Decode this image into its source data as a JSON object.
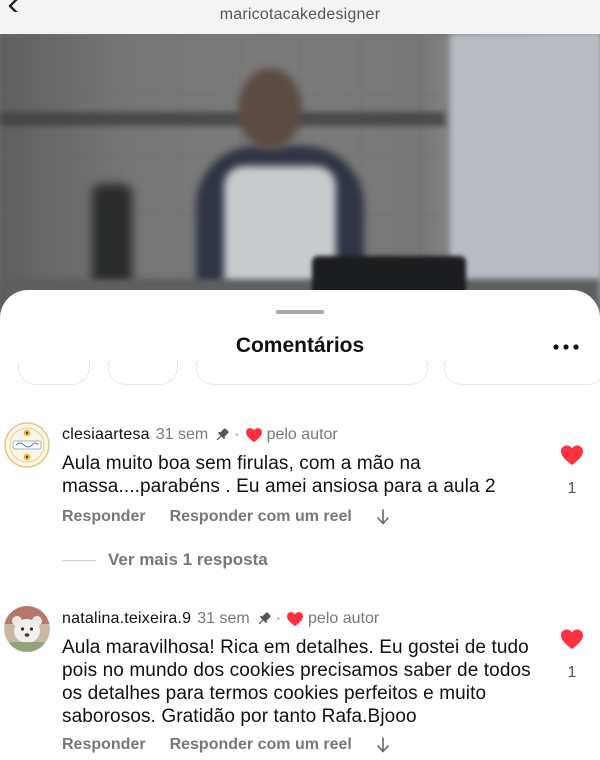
{
  "header": {
    "account_name": "maricotacakedesigner",
    "back_icon": "chevron-left-icon"
  },
  "sheet": {
    "title": "Comentários",
    "more_icon": "more-horizontal-icon"
  },
  "comments": [
    {
      "username": "clesiaartesa",
      "time": "31 sem",
      "pinned": true,
      "by_author_label": "pelo autor",
      "text": "Aula muito boa sem firulas, com a mão na massa....parabéns . Eu amei ansiosa para a aula 2",
      "reply_label": "Responder",
      "reply_reel_label": "Responder com um reel",
      "likes": "1",
      "liked": true,
      "view_more_label": "Ver mais 1 resposta"
    },
    {
      "username": "natalina.teixeira.9",
      "time": "31 sem",
      "pinned": true,
      "by_author_label": "pelo autor",
      "text": "Aula maravilhosa! Rica em detalhes. Eu gostei de tudo pois no mundo dos cookies precisamos saber de todos os detalhes para termos cookies perfeitos e muito saborosos. Gratidão por tanto Rafa.Bjooo",
      "reply_label": "Responder",
      "reply_reel_label": "Responder com um reel",
      "likes": "1",
      "liked": true
    }
  ],
  "colors": {
    "like_red": "#ff3040",
    "muted_text": "#777777",
    "primary_text": "#111111"
  }
}
